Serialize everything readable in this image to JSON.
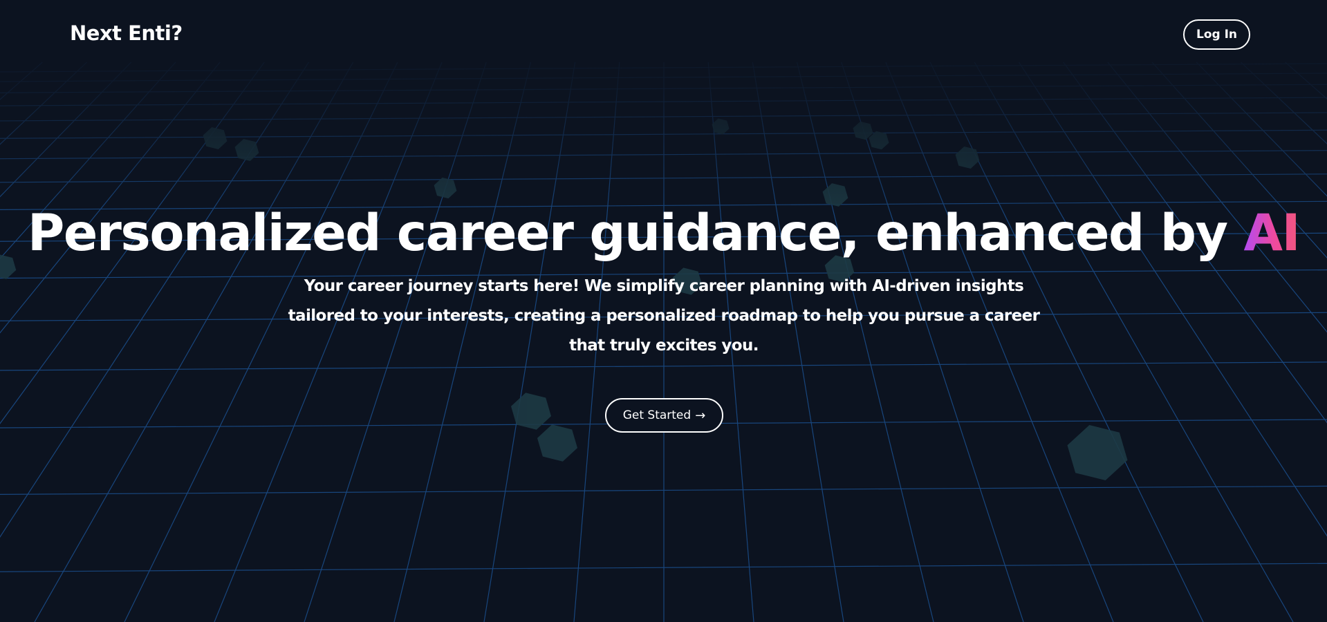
{
  "colors": {
    "background": "#0c1320",
    "grid_line": "#1b4f8e",
    "cube": "#1d3a44",
    "accent_gradient": [
      "#b24bf3",
      "#ee4a9f",
      "#f0567d"
    ]
  },
  "header": {
    "logo_text": "Next Enti?",
    "login_label": "Log In"
  },
  "hero": {
    "title_main": "Personalized career guidance, enhanced by ",
    "title_accent": "AI",
    "subtitle": "Your career journey starts here! We simplify career planning with AI-driven insights tailored to your interests, creating a personalized roadmap to help you pursue a career that truly excites you.",
    "cta_label": "Get Started",
    "cta_icon": "arrow-right-icon"
  },
  "background": {
    "decoration": "perspective-grid-with-floating-cubes"
  }
}
